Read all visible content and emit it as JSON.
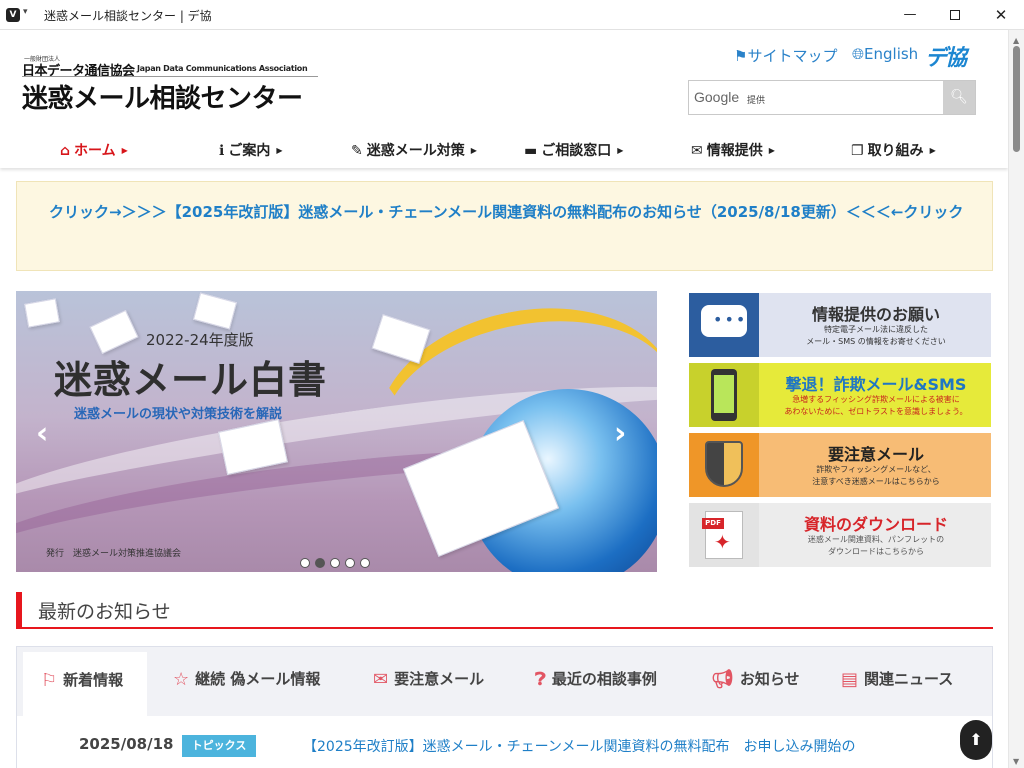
{
  "window": {
    "title": "迷惑メール相談センター | デ協",
    "app_icon": "V",
    "menu_icon": "▾",
    "min_icon": "—",
    "close_icon": "✕"
  },
  "header": {
    "org_small": "一般財団法人",
    "org_name": "日本データ通信協会",
    "org_en": "Japan Data Communications Association",
    "site_title": "迷惑メール相談センター",
    "sitemap": "サイトマップ",
    "english": "English",
    "dekyo_logo": "デ協",
    "search": {
      "google": "Google",
      "provided": "提供",
      "button_icon": "search-icon"
    }
  },
  "nav": [
    {
      "label": "ホーム",
      "icon": "home-icon",
      "active": true
    },
    {
      "label": "ご案内",
      "icon": "info-icon"
    },
    {
      "label": "迷惑メール対策",
      "icon": "pencil-icon"
    },
    {
      "label": "ご相談窓口",
      "icon": "chat-icon"
    },
    {
      "label": "情報提供",
      "icon": "envelope-icon"
    },
    {
      "label": "取り組み",
      "icon": "documents-icon"
    }
  ],
  "notice": {
    "text": "クリック→＞＞＞【2025年改訂版】迷惑メール・チェーンメール関連資料の無料配布のお知らせ（2025/8/18更新）＜＜＜←クリック"
  },
  "slider": {
    "year": "2022-24年度版",
    "title": "迷惑メール白書",
    "subtitle": "迷惑メールの現状や対策技術を解説",
    "publisher": "発行　迷惑メール対策推進協議会",
    "total_slides": 5,
    "active_slide": 2
  },
  "side_banners": [
    {
      "title": "情報提供のお願い",
      "desc1": "特定電子メール法に違反した",
      "desc2": "メール・SMS の情報をお寄せください"
    },
    {
      "title": "撃退！詐欺メール&SMS",
      "desc1": "急増するフィッシング詐欺メールによる被害に",
      "desc2": "あわないために、ゼロトラストを意識しましょう。"
    },
    {
      "title": "要注意メール",
      "desc1": "詐欺やフィッシングメールなど、",
      "desc2": "注意すべき迷惑メールはこちらから"
    },
    {
      "title": "資料のダウンロード",
      "desc1": "迷惑メール関連資料、パンフレットの",
      "desc2": "ダウンロードはこちらから",
      "pdf_tag": "PDF"
    }
  ],
  "news": {
    "heading": "最新のお知らせ",
    "tabs": [
      {
        "label": "新着情報",
        "icon": "signpost-icon",
        "active": true
      },
      {
        "label": "継続 偽メール情報",
        "icon": "star-icon"
      },
      {
        "label": "要注意メール",
        "icon": "envelope-icon"
      },
      {
        "label": "最近の相談事例",
        "icon": "question-icon"
      },
      {
        "label": "お知らせ",
        "icon": "megaphone-icon"
      },
      {
        "label": "関連ニュース",
        "icon": "newspaper-icon"
      }
    ],
    "items": [
      {
        "date": "2025/08/18",
        "badge": "トピックス",
        "title": "【2025年改訂版】迷惑メール・チェーンメール関連資料の無料配布　お申し込み開始の"
      }
    ]
  },
  "colors": {
    "brand_red": "#e7161d",
    "link_blue": "#1f7fc7",
    "notice_bg": "#fdf7e1",
    "badge_blue": "#4cb4dd"
  }
}
